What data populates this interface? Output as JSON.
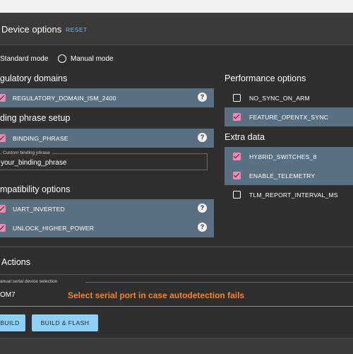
{
  "device_options": {
    "title": "Device options",
    "reset_label": "RESET"
  },
  "mode": {
    "standard_label": "Standard mode",
    "manual_label": "Manual mode",
    "selected": "Standard mode"
  },
  "sections": {
    "regulatory": {
      "title": "gulatory domains",
      "options": [
        {
          "label": "REGULATORY_DOMAIN_ISM_2400",
          "checked": true,
          "help": "?"
        }
      ]
    },
    "binding": {
      "title": "ding phrase setup",
      "options": [
        {
          "label": "BINDING_PHRASE",
          "checked": true,
          "help": "?"
        }
      ],
      "field_label": "Custom binding phrase",
      "field_value": "your_binding_phrase"
    },
    "compatibility": {
      "title": "mpatibility options",
      "options": [
        {
          "label": "UART_INVERTED",
          "checked": true,
          "help": "?"
        },
        {
          "label": "UNLOCK_HIGHER_POWER",
          "checked": true,
          "help": "?"
        }
      ]
    },
    "performance": {
      "title": "Performance options",
      "options": [
        {
          "label": "NO_SYNC_ON_ARM",
          "checked": false
        },
        {
          "label": "FEATURE_OPENTX_SYNC",
          "checked": true
        }
      ]
    },
    "extra": {
      "title": "Extra data",
      "options": [
        {
          "label": "HYBRID_SWITCHES_8",
          "checked": true
        },
        {
          "label": "ENABLE_TELEMETRY",
          "checked": true
        },
        {
          "label": "TLM_REPORT_INTERVAL_MS",
          "checked": false
        }
      ]
    }
  },
  "actions": {
    "title": "Actions",
    "serial_label": "anual serial device selection",
    "serial_value": "OM7",
    "serial_hint": "Select serial port in case autodetection fails",
    "build_label": "BUILD",
    "build_flash_label": "BUILD & FLASH"
  },
  "colors": {
    "accent": "#8fcff5",
    "checkbox": "#f087b3",
    "row_highlight": "#5b7081",
    "hint": "#f58226",
    "link": "#68b4ee"
  }
}
